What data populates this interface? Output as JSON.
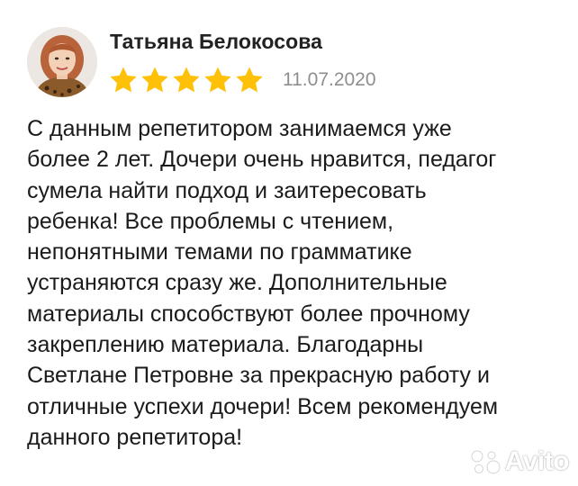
{
  "review": {
    "author_name": "Татьяна Белокосова",
    "rating": 5,
    "rating_max": 5,
    "date": "11.07.2020",
    "text": "С данным репетитором занимаемся уже\nболее 2 лет. Дочери очень нравится, педагог\nсумела найти подход и заитересовать\nребенка! Все проблемы с чтением,\nнепонятными темами по грамматике\nустраняются сразу же. Дополнительные\nматериалы способствуют более прочному\nзакреплению материала. Благодарны\nСветлане Петровне за прекрасную работу и\nотличные успехи дочери! Всем рекомендуем\nданного репетитора!"
  },
  "watermark": {
    "text": "Avito"
  },
  "colors": {
    "star": "#ffc107",
    "date": "#8e8e8e",
    "text": "#1b1b1b"
  },
  "icons": {
    "avatar": "user-photo",
    "star": "star-icon",
    "watermark": "avito-logo-icon"
  }
}
